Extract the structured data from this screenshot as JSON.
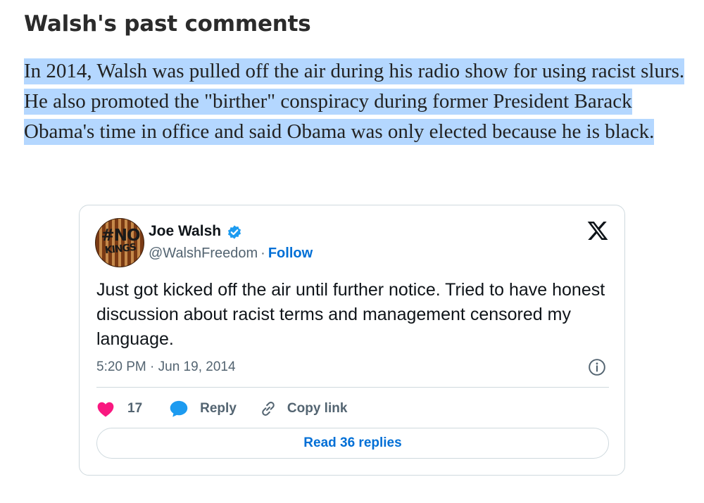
{
  "article": {
    "heading": "Walsh's past comments",
    "paragraph": "In 2014, Walsh was pulled off the air during his radio show for using racist slurs. He also promoted the \"birther\" conspiracy during former President Barack Obama's time in office and said Obama was only elected because he is black.",
    "selection_color": "#b4d7ff"
  },
  "tweet": {
    "avatar": {
      "line1": "#NO",
      "line2": "KINGS"
    },
    "author_name": "Joe Walsh",
    "verified_icon": "verified-badge-icon",
    "handle": "@WalshFreedom",
    "separator": "·",
    "follow_label": "Follow",
    "platform_icon": "x-logo-icon",
    "text": "Just got kicked off the air until further notice. Tried to have honest discussion about racist terms and management censored my language.",
    "timestamp": "5:20 PM · Jun 19, 2014",
    "info_icon": "info-icon",
    "actions": {
      "like_icon": "heart-icon",
      "like_count": "17",
      "reply_icon": "speech-bubble-icon",
      "reply_label": "Reply",
      "copy_icon": "link-icon",
      "copy_label": "Copy link"
    },
    "read_replies_label": "Read 36 replies",
    "colors": {
      "accent": "#006fd6",
      "heart": "#f91880",
      "verified": "#1d9bf0",
      "secondary_text": "#536471",
      "border": "#cfd9de"
    }
  }
}
